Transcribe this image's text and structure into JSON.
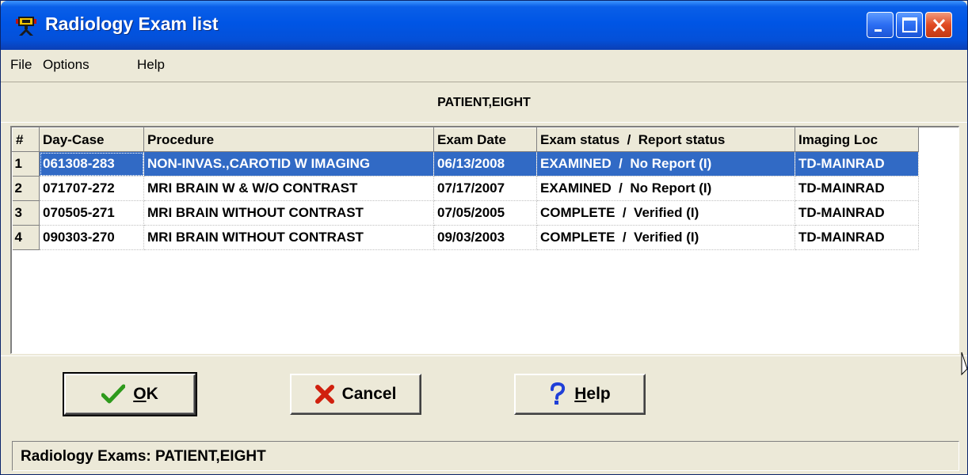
{
  "window": {
    "title": "Radiology Exam list",
    "icon": "radiology-app-icon",
    "controls": [
      "minimize-icon",
      "maximize-icon",
      "close-icon"
    ]
  },
  "menu": {
    "file": "File",
    "options": "Options",
    "help": "Help"
  },
  "patient": {
    "name": "PATIENT,EIGHT"
  },
  "table": {
    "columns": [
      "#",
      "Day-Case",
      "Procedure",
      "Exam Date",
      "Exam status  /  Report status",
      "Imaging Loc"
    ],
    "rows": [
      {
        "num": "1",
        "day_case": "061308-283",
        "procedure": "NON-INVAS.,CAROTID W IMAGING",
        "exam_date": "06/13/2008",
        "status": "EXAMINED  /  No Report (I)",
        "imaging_loc": "TD-MAINRAD"
      },
      {
        "num": "2",
        "day_case": "071707-272",
        "procedure": "MRI BRAIN W & W/O CONTRAST",
        "exam_date": "07/17/2007",
        "status": "EXAMINED  /  No Report (I)",
        "imaging_loc": "TD-MAINRAD"
      },
      {
        "num": "3",
        "day_case": "070505-271",
        "procedure": "MRI BRAIN WITHOUT CONTRAST",
        "exam_date": "07/05/2005",
        "status": "COMPLETE  /  Verified (I)",
        "imaging_loc": "TD-MAINRAD"
      },
      {
        "num": "4",
        "day_case": "090303-270",
        "procedure": "MRI BRAIN WITHOUT CONTRAST",
        "exam_date": "09/03/2003",
        "status": "COMPLETE  /  Verified (I)",
        "imaging_loc": "TD-MAINRAD"
      }
    ],
    "selected_row": "1"
  },
  "buttons": {
    "ok": {
      "mnemonic": "O",
      "rest": "K",
      "icon": "checkmark-icon"
    },
    "cancel": {
      "label": "Cancel",
      "icon": "x-icon"
    },
    "help": {
      "mnemonic": "H",
      "rest": "elp",
      "icon": "question-mark-icon"
    }
  },
  "status": {
    "text": "Radiology Exams: PATIENT,EIGHT"
  },
  "colors": {
    "titlebar": "#0055e5",
    "selection": "#316ac5",
    "window_bg": "#ece9d8",
    "check_green": "#2e9a1c",
    "cancel_red": "#d0200e",
    "help_blue": "#1f3fd8"
  }
}
